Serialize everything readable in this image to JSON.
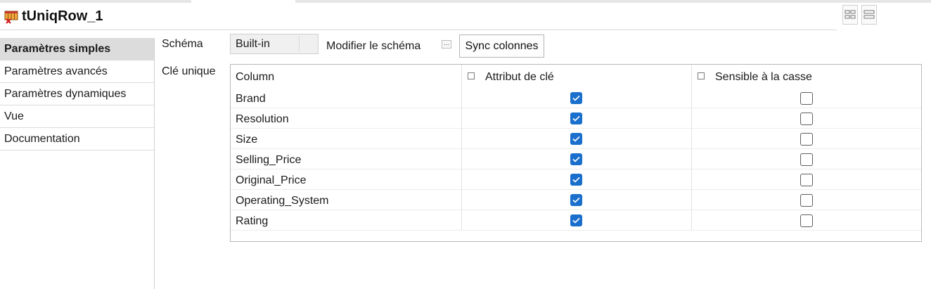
{
  "component": {
    "title": "tUniqRow_1",
    "icon": "component-unique-row-icon"
  },
  "sidebar": {
    "items": [
      {
        "label": "Paramètres simples",
        "active": true
      },
      {
        "label": "Paramètres avancés",
        "active": false
      },
      {
        "label": "Paramètres dynamiques",
        "active": false
      },
      {
        "label": "Vue",
        "active": false
      },
      {
        "label": "Documentation",
        "active": false
      }
    ]
  },
  "schema": {
    "label": "Schéma",
    "selected": "Built-in",
    "edit_label": "Modifier le schéma",
    "sync_label": "Sync colonnes"
  },
  "unique_key": {
    "label": "Clé unique",
    "headers": {
      "column": "Column",
      "key_attribute": "Attribut de clé",
      "case_sensitive": "Sensible à la casse"
    },
    "rows": [
      {
        "column": "Brand",
        "key": true,
        "case_sensitive": false
      },
      {
        "column": "Resolution",
        "key": true,
        "case_sensitive": false
      },
      {
        "column": "Size",
        "key": true,
        "case_sensitive": false
      },
      {
        "column": "Selling_Price",
        "key": true,
        "case_sensitive": false
      },
      {
        "column": "Original_Price",
        "key": true,
        "case_sensitive": false
      },
      {
        "column": "Operating_System",
        "key": true,
        "case_sensitive": false
      },
      {
        "column": "Rating",
        "key": true,
        "case_sensitive": false
      }
    ]
  },
  "colors": {
    "accent_checkbox": "#1a6fcc",
    "active_sidebar_bg": "#dcdcdc"
  }
}
